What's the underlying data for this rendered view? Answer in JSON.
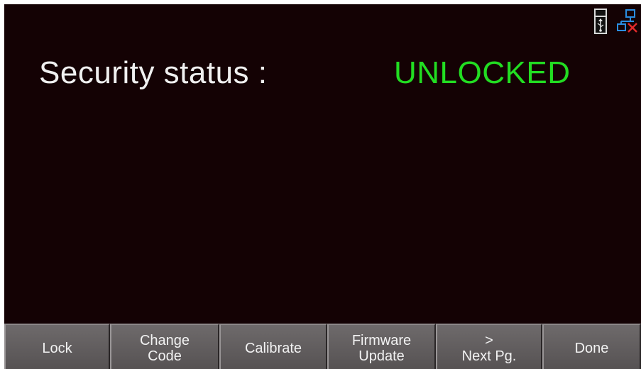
{
  "status_icons": {
    "usb": "usb-storage-icon",
    "network": "network-disconnected-icon"
  },
  "security": {
    "label": "Security status :",
    "value": "UNLOCKED",
    "value_color": "#22dd22"
  },
  "softkeys": [
    {
      "line1": "Lock",
      "line2": ""
    },
    {
      "line1": "Change",
      "line2": "Code"
    },
    {
      "line1": "Calibrate",
      "line2": ""
    },
    {
      "line1": "Firmware",
      "line2": "Update"
    },
    {
      "line1": ">",
      "line2": "Next Pg."
    },
    {
      "line1": "Done",
      "line2": ""
    }
  ]
}
